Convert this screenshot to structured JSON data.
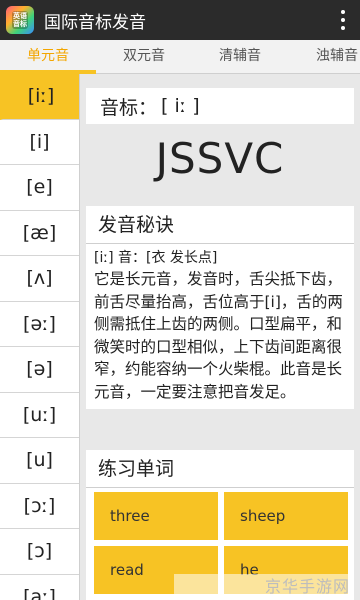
{
  "app": {
    "title": "国际音标发音",
    "icon_text": "英语\n音标"
  },
  "tabs": [
    "单元音",
    "双元音",
    "清辅音",
    "浊辅音"
  ],
  "active_tab": 0,
  "sidebar": {
    "items": [
      "[iː]",
      "[i]",
      "[e]",
      "[æ]",
      "[ʌ]",
      "[əː]",
      "[ə]",
      "[uː]",
      "[u]",
      "[ɔː]",
      "[ɔ]",
      "[aː]"
    ],
    "active_index": 0
  },
  "phonetic": {
    "label": "音标：",
    "value": "[ iː ]"
  },
  "example_word": "JSSVC",
  "tips": {
    "heading": "发音秘诀",
    "first_line": "[iː] 音：[衣  发长点]",
    "text": "它是长元音，发音时，舌尖抵下齿，前舌尽量抬高，舌位高于[i]，舌的两侧需抵住上齿的两侧。口型扁平，和微笑时的口型相似，上下齿间距离很窄，约能容纳一个火柴棍。此音是长元音，一定要注意把音发足。"
  },
  "practice": {
    "heading": "练习单词",
    "words": [
      "three",
      "sheep",
      "read",
      "he"
    ]
  },
  "watermark": "京华手游网",
  "colors": {
    "accent": "#f7c324",
    "accent_text": "#f3a600",
    "titlebar": "#2b2b2b"
  }
}
